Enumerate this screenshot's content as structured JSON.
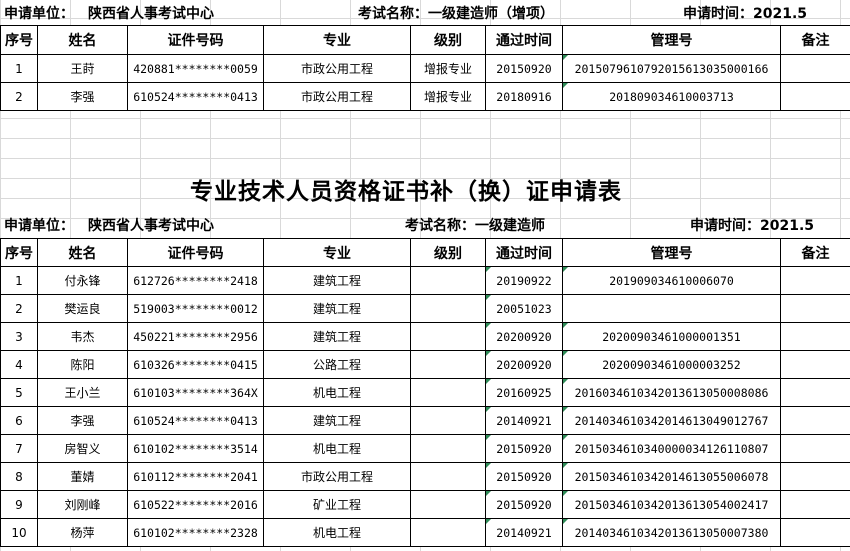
{
  "columns": [
    "序号",
    "姓名",
    "证件号码",
    "专业",
    "级别",
    "通过时间",
    "管理号",
    "备注"
  ],
  "top": {
    "unit_label": "申请单位：",
    "unit_value": "陕西省人事考试中心",
    "exam_label": "考试名称：",
    "exam_value": "一级建造师（增项）",
    "time_label": "申请时间：",
    "time_value": "2021.5",
    "rows": [
      {
        "no": "1",
        "name": "王莳",
        "id": "420881********0059",
        "major": "市政公用工程",
        "level": "增报专业",
        "date": "20150920",
        "mgmt": "20150796107920156130350001​66",
        "note": ""
      },
      {
        "no": "2",
        "name": "李强",
        "id": "610524********0413",
        "major": "市政公用工程",
        "level": "增报专业",
        "date": "20180916",
        "mgmt": "201809034610003713",
        "note": ""
      }
    ]
  },
  "title": "专业技术人员资格证书补（换）证申请表",
  "bottom": {
    "unit_label": "申请单位：",
    "unit_value": "陕西省人事考试中心",
    "exam_label": "考试名称：",
    "exam_value": "一级建造师",
    "time_label": "申请时间：",
    "time_value": "2021.5",
    "rows": [
      {
        "no": "1",
        "name": "付永锋",
        "id": "612726********2418",
        "major": "建筑工程",
        "level": "",
        "date": "20190922",
        "mgmt": "201909034610006070",
        "note": ""
      },
      {
        "no": "2",
        "name": "樊运良",
        "id": "519003********0012",
        "major": "建筑工程",
        "level": "",
        "date": "20051023",
        "mgmt": "",
        "note": ""
      },
      {
        "no": "3",
        "name": "韦杰",
        "id": "450221********2956",
        "major": "建筑工程",
        "level": "",
        "date": "20200920",
        "mgmt": "20200903461000001351",
        "note": ""
      },
      {
        "no": "4",
        "name": "陈阳",
        "id": "610326********0415",
        "major": "公路工程",
        "level": "",
        "date": "20200920",
        "mgmt": "20200903461000003252",
        "note": ""
      },
      {
        "no": "5",
        "name": "王小兰",
        "id": "610103********364X",
        "major": "机电工程",
        "level": "",
        "date": "20160925",
        "mgmt": "20160346103420136130500080​86",
        "note": ""
      },
      {
        "no": "6",
        "name": "李强",
        "id": "610524********0413",
        "major": "建筑工程",
        "level": "",
        "date": "20140921",
        "mgmt": "20140346103420146130490127​67",
        "note": ""
      },
      {
        "no": "7",
        "name": "房智义",
        "id": "610102********3514",
        "major": "机电工程",
        "level": "",
        "date": "20150920",
        "mgmt": "2015034610340000034126110807",
        "note": ""
      },
      {
        "no": "8",
        "name": "董婧",
        "id": "610112********2041",
        "major": "市政公用工程",
        "level": "",
        "date": "20150920",
        "mgmt": "2015034610342014613055006078",
        "note": ""
      },
      {
        "no": "9",
        "name": "刘刚峰",
        "id": "610522********2016",
        "major": "矿业工程",
        "level": "",
        "date": "20150920",
        "mgmt": "2015034610342013613054002417",
        "note": ""
      },
      {
        "no": "10",
        "name": "杨萍",
        "id": "610102********2328",
        "major": "机电工程",
        "level": "",
        "date": "20140921",
        "mgmt": "2014034610342013613050007380",
        "note": ""
      }
    ]
  }
}
